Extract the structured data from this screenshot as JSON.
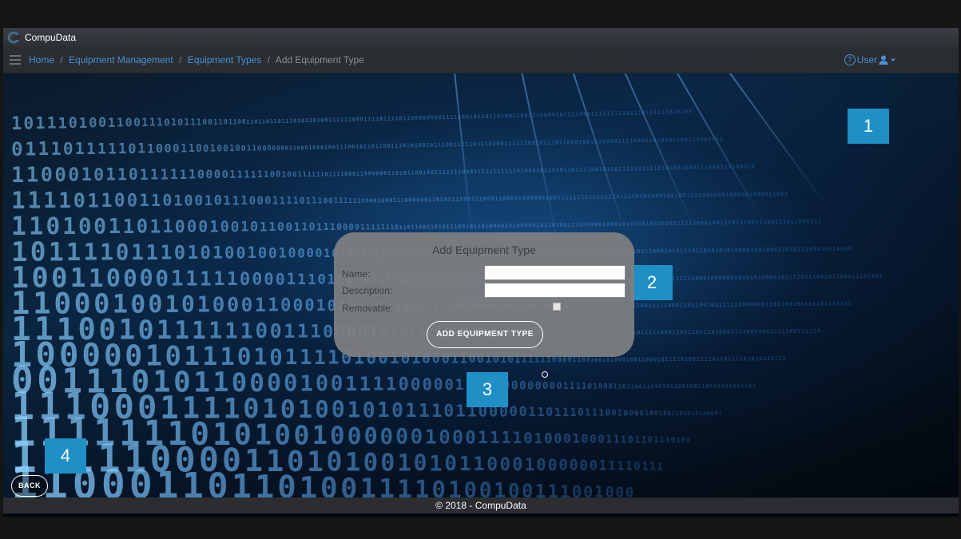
{
  "app": {
    "title": "CompuData"
  },
  "breadcrumb": {
    "items": [
      "Home",
      "Equipment Management",
      "Equipment Types"
    ],
    "separator": "/",
    "current": "Add Equipment Type"
  },
  "user_menu": {
    "label": "User",
    "help_icon": "question-circle-icon",
    "user_icon": "user-icon",
    "caret_icon": "caret-down-icon"
  },
  "form": {
    "title": "Add Equipment Type",
    "name_label": "Name:",
    "name_value": "",
    "description_label": "Description:",
    "description_value": "",
    "removable_label": "Removable:",
    "removable_checked": false,
    "submit_label": "ADD EQUIPMENT TYPE"
  },
  "back_button": {
    "label": "BACK"
  },
  "footer": {
    "text": "© 2018 - CompuData"
  },
  "callouts": [
    "1",
    "2",
    "3",
    "4"
  ],
  "colors": {
    "accent": "#1f8fc6",
    "link": "#4a90d8",
    "navbar": "#2a2d31",
    "panel": "#808080"
  }
}
